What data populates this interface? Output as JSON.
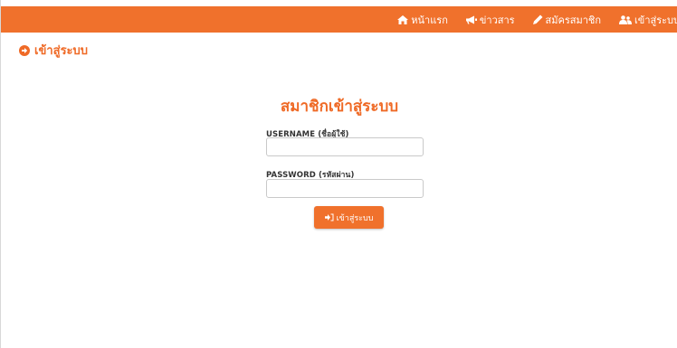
{
  "navbar": {
    "items": [
      {
        "label": "หน้าแรก",
        "icon": "home-icon"
      },
      {
        "label": "ข่าวสาร",
        "icon": "bullhorn-icon"
      },
      {
        "label": "สมัครสมาชิก",
        "icon": "pencil-icon"
      },
      {
        "label": "เข้าสู่ระบบ",
        "icon": "users-icon"
      }
    ]
  },
  "page": {
    "title": "เข้าสู่ระบบ",
    "title_icon": "arrow-circle-right-icon"
  },
  "login_form": {
    "heading": "สมาชิกเข้าสู่ระบบ",
    "username_label": "USERNAME (ชื่อผู้ใช้)",
    "username_value": "",
    "password_label": "PASSWORD (รหัสผ่าน)",
    "password_value": "",
    "submit_label": "เข้าสู่ระบบ",
    "submit_icon": "sign-in-icon"
  },
  "colors": {
    "accent": "#f0712c",
    "text": "#333333",
    "background": "#ffffff"
  }
}
